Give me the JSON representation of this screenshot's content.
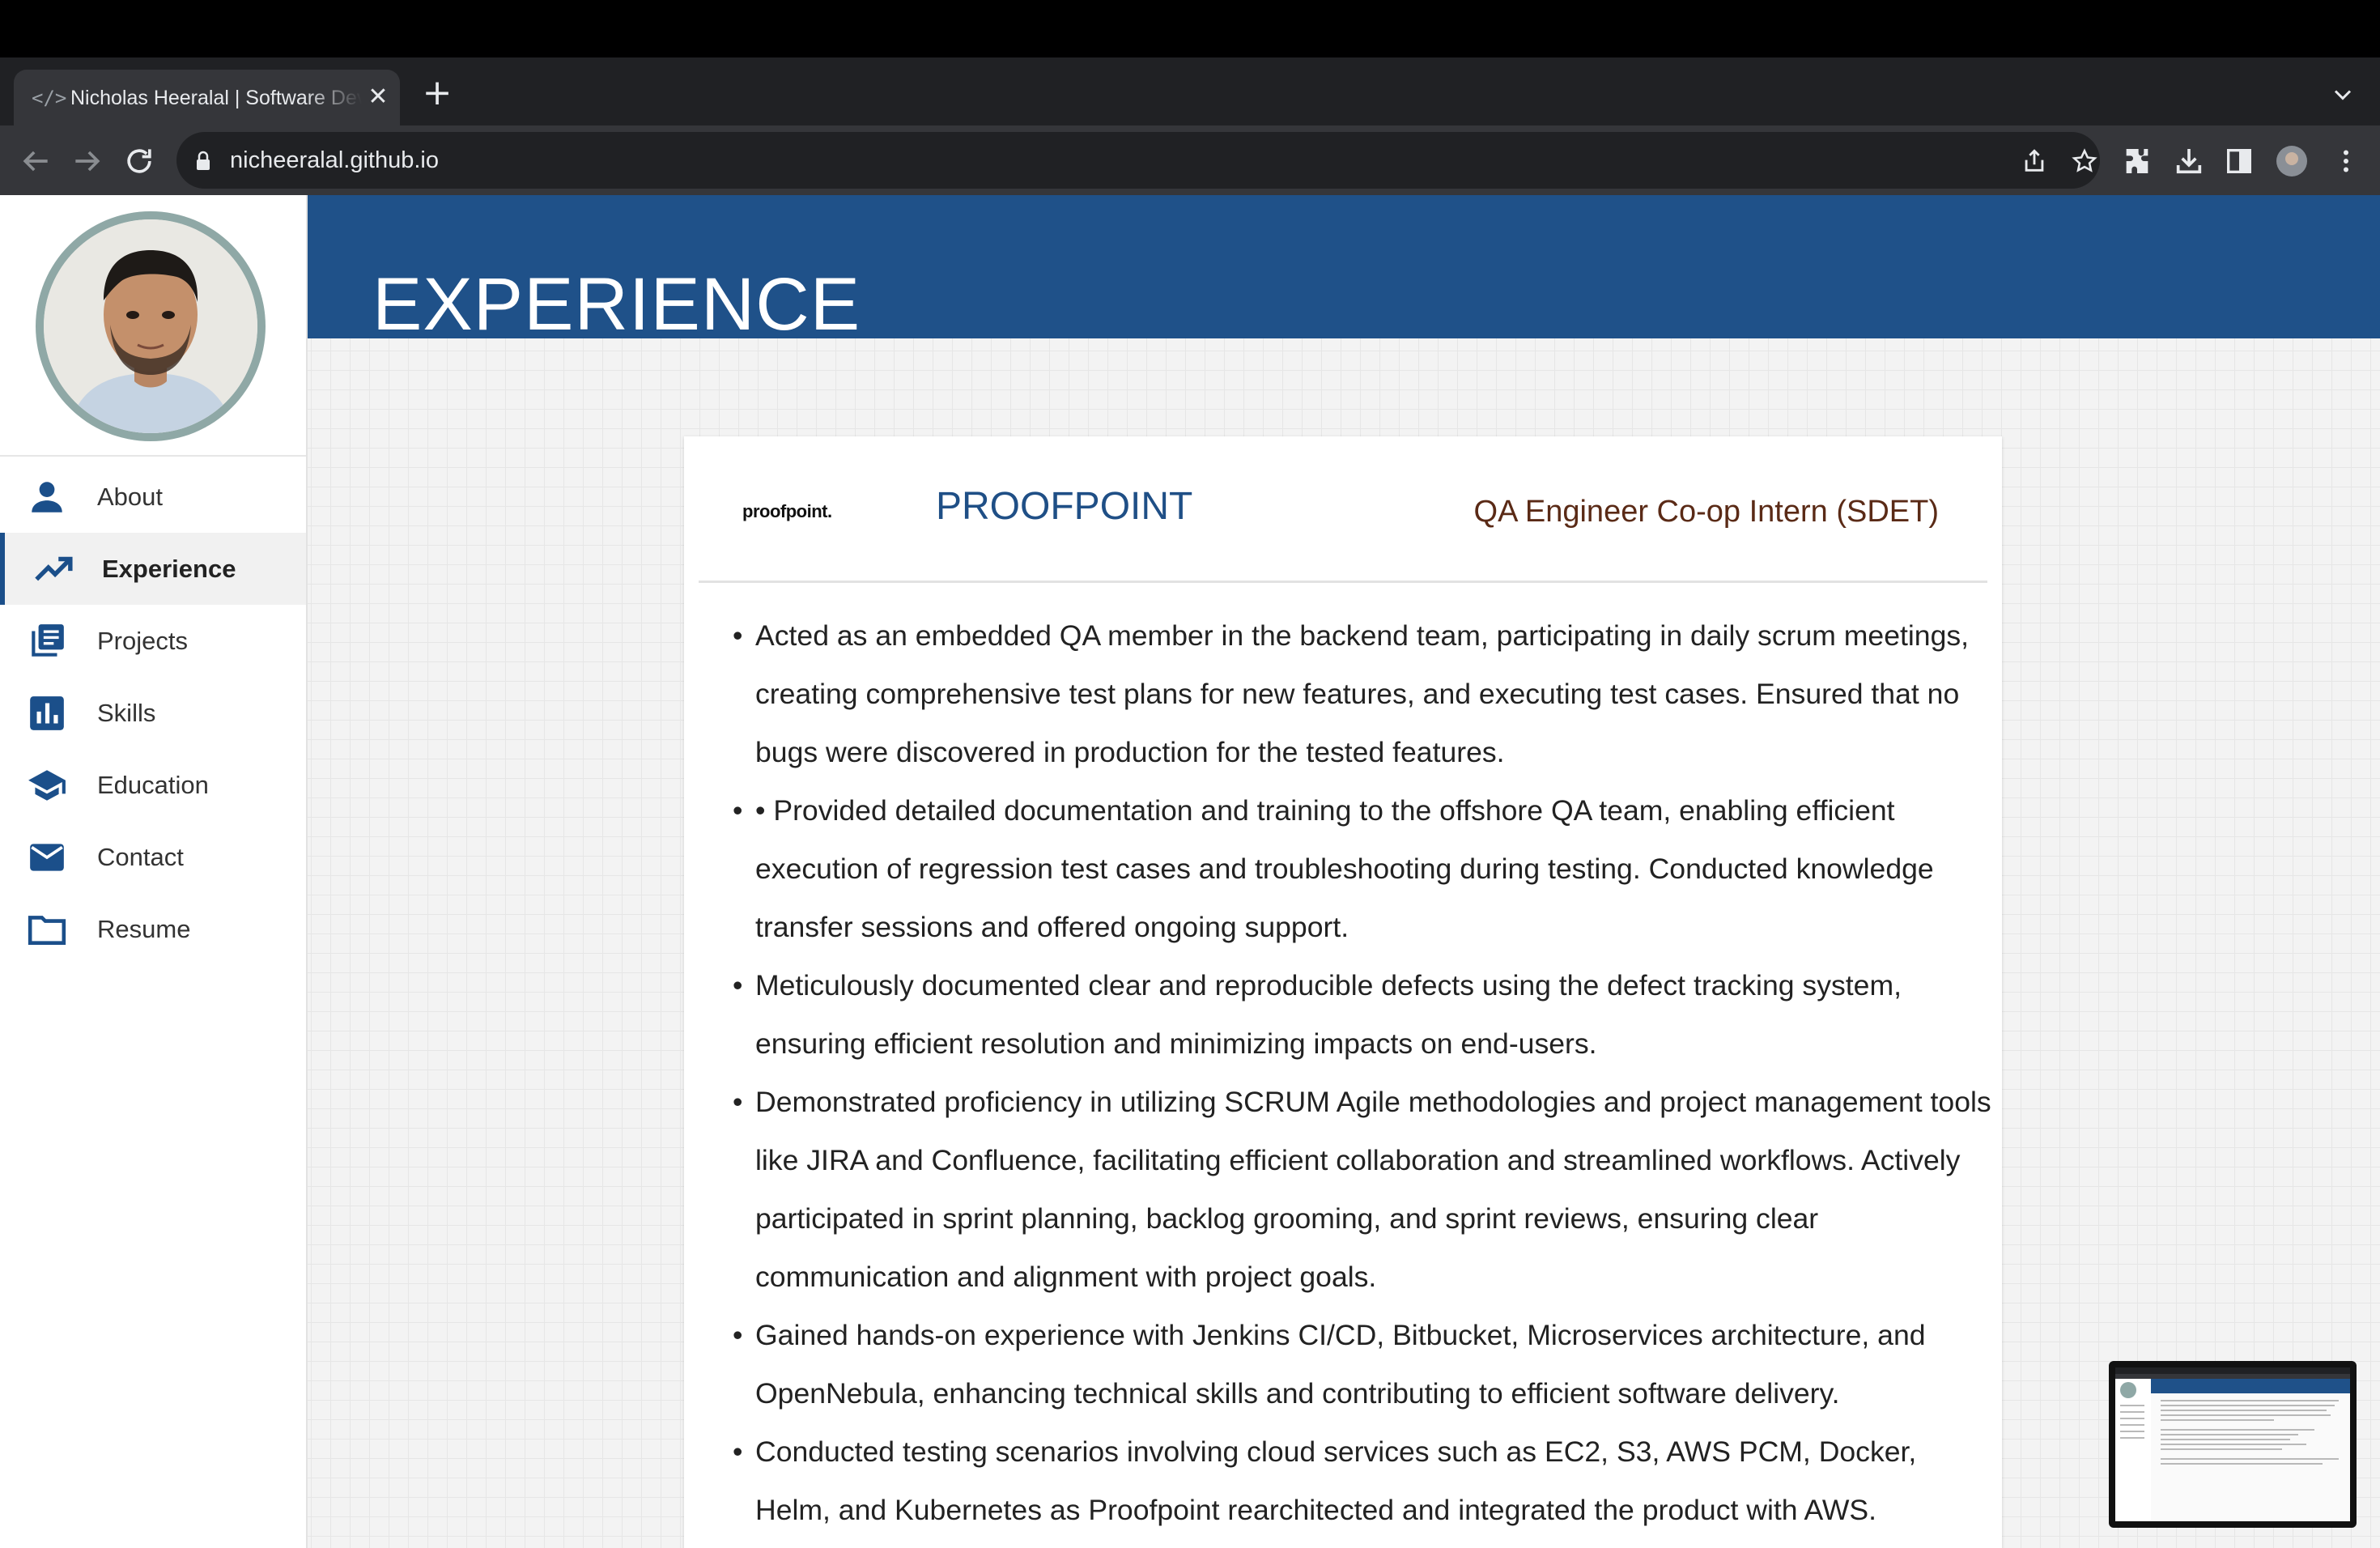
{
  "browser": {
    "tab_title": "Nicholas Heeralal | Software Developer",
    "tab_favicon": "</>",
    "url": "nicheeralal.github.io",
    "icons": [
      "back-icon",
      "forward-icon",
      "reload-icon",
      "lock-icon",
      "share-icon",
      "star-icon",
      "extensions-icon",
      "download-icon",
      "side-panel-icon",
      "profile-avatar",
      "menu-icon",
      "tab-list-icon",
      "new-tab-icon",
      "close-icon"
    ]
  },
  "sidebar": {
    "items": [
      {
        "label": "About",
        "icon": "person-icon",
        "active": false
      },
      {
        "label": "Experience",
        "icon": "trending-up-icon",
        "active": true
      },
      {
        "label": "Projects",
        "icon": "library-books-icon",
        "active": false
      },
      {
        "label": "Skills",
        "icon": "bar-chart-icon",
        "active": false
      },
      {
        "label": "Education",
        "icon": "school-icon",
        "active": false
      },
      {
        "label": "Contact",
        "icon": "mail-icon",
        "active": false
      },
      {
        "label": "Resume",
        "icon": "folder-icon",
        "active": false
      }
    ]
  },
  "header": {
    "title": "EXPERIENCE"
  },
  "experience": {
    "logo_text": "proofpoint.",
    "company": "PROOFPOINT",
    "role": "QA Engineer Co-op Intern (SDET)",
    "bullets": [
      "Acted as an embedded QA member in the backend team, participating in daily scrum meetings, creating comprehensive test plans for new features, and executing test cases. Ensured that no bugs were discovered in production for the tested features.",
      "• Provided detailed documentation and training to the offshore QA team, enabling efficient execution of regression test cases and troubleshooting during testing. Conducted knowledge transfer sessions and offered ongoing support.",
      "Meticulously documented clear and reproducible defects using the defect tracking system, ensuring efficient resolution and minimizing impacts on end-users.",
      "Demonstrated proficiency in utilizing SCRUM Agile methodologies and project management tools like JIRA and Confluence, facilitating efficient collaboration and streamlined workflows. Actively participated in sprint planning, backlog grooming, and sprint reviews, ensuring clear communication and alignment with project goals.",
      "Gained hands-on experience with Jenkins CI/CD, Bitbucket, Microservices architecture, and OpenNebula, enhancing technical skills and contributing to efficient software delivery.",
      "Conducted testing scenarios involving cloud services such as EC2, S3, AWS PCM, Docker, Helm, and Kubernetes as Proofpoint rearchitected and integrated the product with AWS."
    ]
  },
  "colors": {
    "header_bg": "#1f5189",
    "company": "#1f4f86",
    "role": "#5a2a16",
    "nav_icon": "#1b4f8a"
  }
}
